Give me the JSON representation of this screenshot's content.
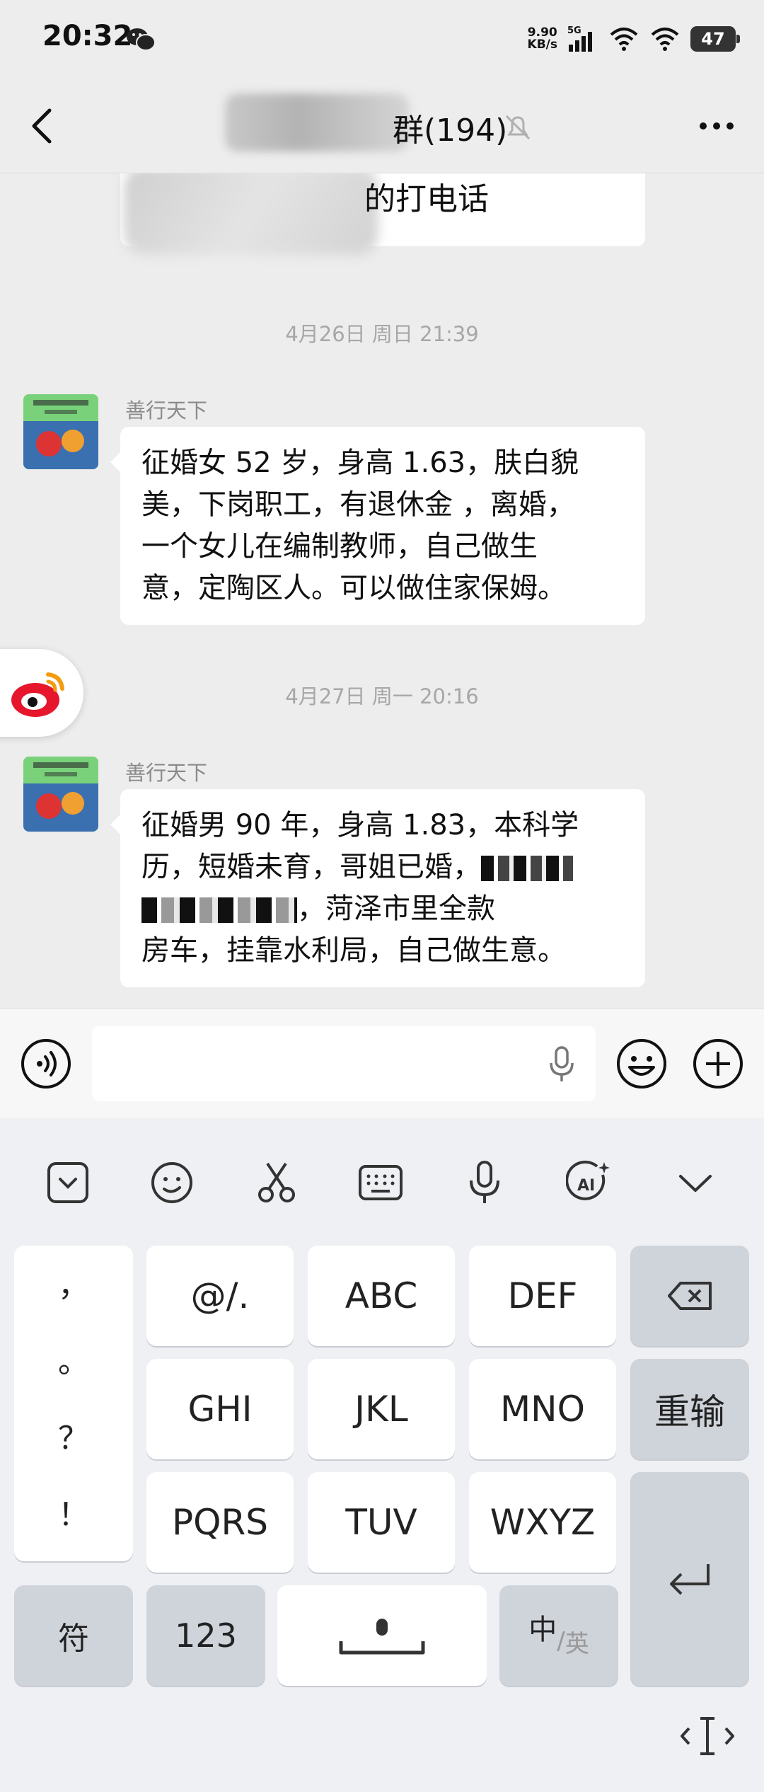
{
  "status_bar": {
    "time": "20:32",
    "net_speed_value": "9.90",
    "net_speed_unit": "KB/s",
    "network": "5G",
    "battery": "47"
  },
  "header": {
    "title_visible": "群(194)",
    "icons": [
      "back-icon",
      "mute-bell-icon",
      "more-icon"
    ]
  },
  "chat": {
    "previous_fragment": "的打电话",
    "messages": [
      {
        "timestamp": "4月26日 周日 21:39",
        "sender": "善行天下",
        "lines": [
          "征婚女 52 岁，身高 1.63，肤白貌",
          "美，下岗职工，有退休金 ，离婚，",
          "一个女儿在编制教师，自己做生",
          "意，定陶区人。可以做住家保姆。"
        ]
      },
      {
        "timestamp": "4月27日 周一 20:16",
        "sender": "善行天下",
        "lines": [
          "征婚男 90 年，身高 1.83，本科学",
          "历，短婚未育，哥姐已婚，",
          "，菏泽市里全款",
          "房车，挂靠水利局，自己做生意。"
        ]
      }
    ]
  },
  "input_bar": {
    "placeholder": "",
    "icons": [
      "voice-icon",
      "mic-icon",
      "emoji-icon",
      "plus-icon"
    ]
  },
  "keyboard": {
    "toolbar_icons": [
      "keyboard-switch-icon",
      "emoticon-icon",
      "scissors-icon",
      "keyboard-icon",
      "microphone-icon",
      "ai-icon",
      "collapse-icon"
    ],
    "punctuation": [
      "，",
      "。",
      "？",
      "！"
    ],
    "row1": [
      "@/.",
      "ABC",
      "DEF"
    ],
    "row2": [
      "GHI",
      "JKL",
      "MNO"
    ],
    "row3": [
      "PQRS",
      "TUV",
      "WXYZ"
    ],
    "reinput": "重输",
    "symbols": "符",
    "numbers": "123",
    "lang_zh": "中",
    "lang_en": "英",
    "colors": {
      "key": "#ffffff",
      "function_key": "#cfd3da",
      "background": "#eef0f3"
    }
  }
}
